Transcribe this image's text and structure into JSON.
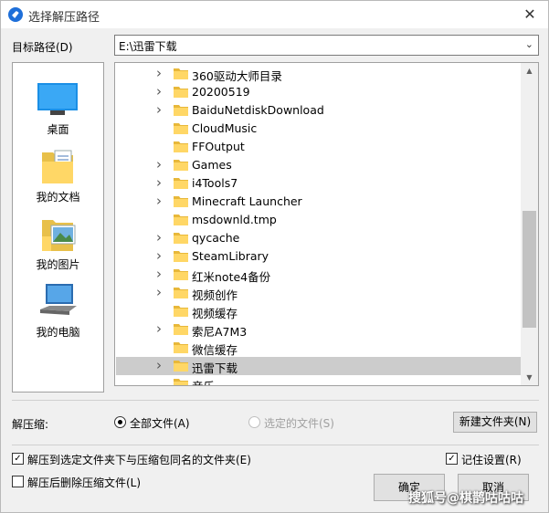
{
  "window": {
    "title": "选择解压路径"
  },
  "target_path": {
    "label": "目标路径(D)",
    "value": "E:\\迅雷下载"
  },
  "places": [
    {
      "label": "桌面",
      "icon": "desktop-icon"
    },
    {
      "label": "我的文档",
      "icon": "documents-icon"
    },
    {
      "label": "我的图片",
      "icon": "pictures-icon"
    },
    {
      "label": "我的电脑",
      "icon": "computer-icon"
    }
  ],
  "folders": [
    {
      "name": "360驱动大师目录",
      "expandable": true,
      "selected": false
    },
    {
      "name": "20200519",
      "expandable": true,
      "selected": false
    },
    {
      "name": "BaiduNetdiskDownload",
      "expandable": true,
      "selected": false
    },
    {
      "name": "CloudMusic",
      "expandable": false,
      "selected": false
    },
    {
      "name": "FFOutput",
      "expandable": false,
      "selected": false
    },
    {
      "name": "Games",
      "expandable": true,
      "selected": false
    },
    {
      "name": "i4Tools7",
      "expandable": true,
      "selected": false
    },
    {
      "name": "Minecraft Launcher",
      "expandable": true,
      "selected": false
    },
    {
      "name": "msdownld.tmp",
      "expandable": false,
      "selected": false
    },
    {
      "name": "qycache",
      "expandable": true,
      "selected": false
    },
    {
      "name": "SteamLibrary",
      "expandable": true,
      "selected": false
    },
    {
      "name": "红米note4备份",
      "expandable": true,
      "selected": false
    },
    {
      "name": "视频创作",
      "expandable": true,
      "selected": false
    },
    {
      "name": "视频缓存",
      "expandable": false,
      "selected": false
    },
    {
      "name": "索尼A7M3",
      "expandable": true,
      "selected": false
    },
    {
      "name": "微信缓存",
      "expandable": false,
      "selected": false
    },
    {
      "name": "迅雷下载",
      "expandable": true,
      "selected": true
    },
    {
      "name": "音乐",
      "expandable": false,
      "selected": false
    }
  ],
  "extract": {
    "label": "解压缩:",
    "all_files": "全部文件(A)",
    "selected_files": "选定的文件(S)",
    "new_folder_button": "新建文件夹(N)"
  },
  "options": {
    "extract_to_subfolder": {
      "label": "解压到选定文件夹下与压缩包同名的文件夹(E)",
      "checked": true
    },
    "delete_after": {
      "label": "解压后删除压缩文件(L)",
      "checked": false
    },
    "remember": {
      "label": "记住设置(R)",
      "checked": true
    }
  },
  "buttons": {
    "ok": "确定",
    "cancel": "取消"
  },
  "watermark": "搜狐号@棋鹊咕咕咕",
  "colors": {
    "folder": "#ffd766",
    "selection": "#cccccc",
    "accent": "#1e6fd9"
  }
}
